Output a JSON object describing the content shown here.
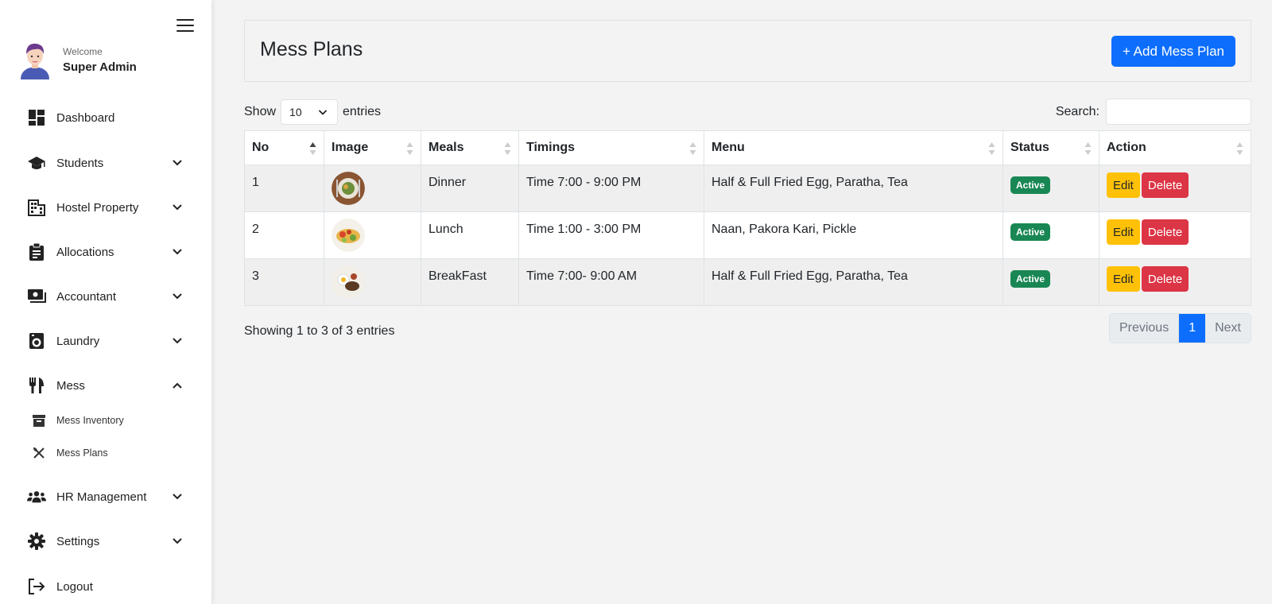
{
  "sidebar": {
    "welcome": "Welcome",
    "username": "Super Admin",
    "items": [
      {
        "label": "Dashboard"
      },
      {
        "label": "Students"
      },
      {
        "label": "Hostel Property"
      },
      {
        "label": "Allocations"
      },
      {
        "label": "Accountant"
      },
      {
        "label": "Laundry"
      },
      {
        "label": "Mess"
      },
      {
        "label": "HR Management"
      },
      {
        "label": "Settings"
      },
      {
        "label": "Logout"
      }
    ],
    "mess_sub": [
      {
        "label": "Mess Inventory"
      },
      {
        "label": "Mess Plans"
      }
    ]
  },
  "header": {
    "title": "Mess Plans",
    "add_button": "+ Add Mess Plan"
  },
  "controls": {
    "show_label": "Show",
    "entries_value": "10",
    "entries_label": "entries",
    "search_label": "Search:",
    "search_value": ""
  },
  "table": {
    "columns": [
      "No",
      "Image",
      "Meals",
      "Timings",
      "Menu",
      "Status",
      "Action"
    ],
    "rows": [
      {
        "no": "1",
        "meal": "Dinner",
        "timing": "Time 7:00 - 9:00 PM",
        "menu": "Half & Full Fried Egg, Paratha, Tea",
        "status": "Active"
      },
      {
        "no": "2",
        "meal": "Lunch",
        "timing": "Time 1:00 - 3:00 PM",
        "menu": "Naan, Pakora Kari, Pickle",
        "status": "Active"
      },
      {
        "no": "3",
        "meal": "BreakFast",
        "timing": "Time 7:00- 9:00 AM",
        "menu": "Half & Full Fried Egg, Paratha, Tea",
        "status": "Active"
      }
    ],
    "edit_label": "Edit",
    "delete_label": "Delete"
  },
  "footer": {
    "info": "Showing 1 to 3 of 3 entries",
    "previous": "Previous",
    "page": "1",
    "next": "Next"
  },
  "colors": {
    "primary": "#0d6efd",
    "success": "#198754",
    "warning": "#ffc107",
    "danger": "#dc3545"
  }
}
